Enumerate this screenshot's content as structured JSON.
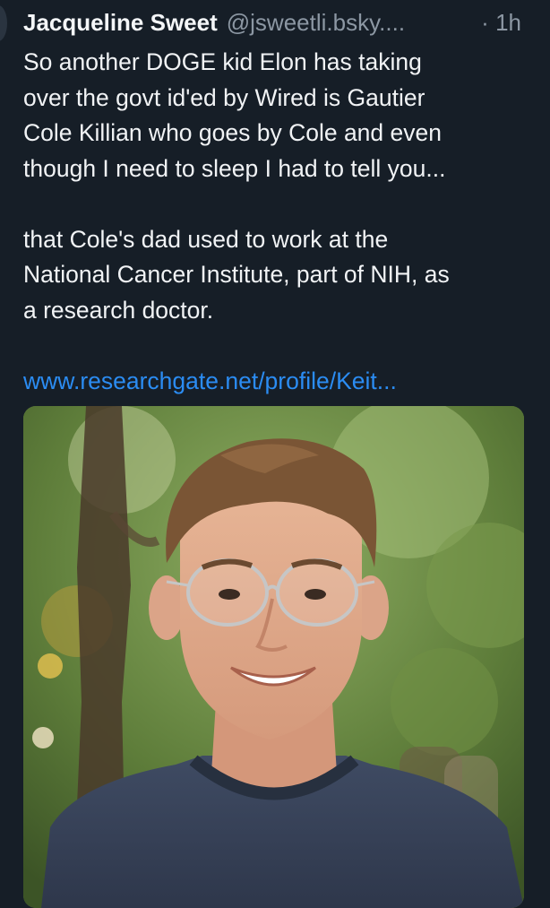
{
  "post": {
    "author_name": "Jacqueline Sweet",
    "author_handle": "@jsweetli.bsky....",
    "separator": "·",
    "timestamp": "1h",
    "paragraph1": "So another DOGE kid Elon has taking\nover the govt id'ed by Wired is Gautier\nCole Killian who goes by Cole and even\nthough I need to sleep I had to tell you...",
    "paragraph2": "that Cole's dad used to work at the\nNational Cancer Institute, part of NIH, as\na research doctor.",
    "link_text": "www.researchgate.net/profile/Keit...",
    "link_color": "#2b8cf2"
  },
  "colors": {
    "background": "#161e27",
    "text": "#f1f3f5",
    "muted": "#8c97a3"
  }
}
